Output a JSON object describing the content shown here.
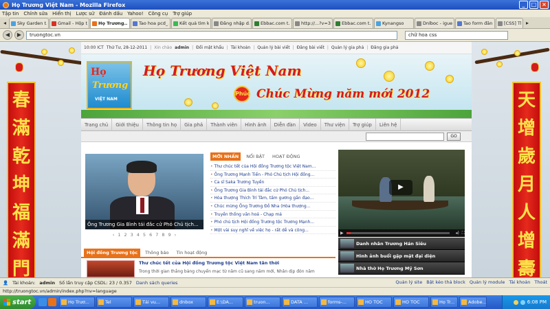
{
  "window": {
    "title": "Họ Trương Việt Nam - Mozilla Firefox",
    "controls": [
      "_",
      "□",
      "×"
    ]
  },
  "menubar": [
    "Tập tin",
    "Chỉnh sửa",
    "Hiển thị",
    "Lược sử",
    "Đánh dấu",
    "Yahoo!",
    "Công cụ",
    "Trợ giúp"
  ],
  "browser_tabs": [
    {
      "label": "Sky Garden t...",
      "color": "#4aa3df"
    },
    {
      "label": "Gmail - Hộp t...",
      "color": "#d93025"
    },
    {
      "label": "Họ Trương...",
      "color": "#e8711a",
      "active": true
    },
    {
      "label": "Tao hoa pcd_...",
      "color": "#5577cc"
    },
    {
      "label": "Kết quả tìm ki...",
      "color": "#3cba54"
    },
    {
      "label": "Đăng nhập d...",
      "color": "#888888"
    },
    {
      "label": "Ebbac.com t...",
      "color": "#2e7d32"
    },
    {
      "label": "http://...?v=3.2",
      "color": "#888888"
    },
    {
      "label": "Ebbac.com t...",
      "color": "#2e7d32"
    },
    {
      "label": "Kynangso",
      "color": "#4aa3df"
    },
    {
      "label": "Dnlboc - igue...",
      "color": "#888888"
    },
    {
      "label": "Tao form đăn...",
      "color": "#5577cc"
    },
    {
      "label": "[CSS] Thay",
      "color": "#888888"
    }
  ],
  "address": {
    "url": "truongtoc.vn",
    "search_value": "chữ hoa css"
  },
  "site": {
    "time": "10:00 ICT",
    "date": "Thứ Tư, 28-12-2011",
    "greeting": "Xin chào",
    "user": "admin",
    "top_links": [
      "Đổi mật khẩu",
      "Tài khoản",
      "Quản lý bài viết",
      "Đăng bài viết",
      "Quản lý gia phả",
      "Đăng gia phả"
    ],
    "logo": {
      "line1": "Họ",
      "line2": "Trương",
      "line3": "VIỆT NAM"
    },
    "banner_title": "Họ Trương Việt Nam",
    "banner_greeting": "Chúc Mừng năm mới 2012",
    "phuc": "Phúc",
    "nav": [
      "Trang chủ",
      "Giới thiệu",
      "Thông tin họ",
      "Gia phả",
      "Thành viên",
      "Hình ảnh",
      "Diễn đàn",
      "Video",
      "Thư viện",
      "Trợ giúp",
      "Liên hệ"
    ],
    "go_label": "GO",
    "featured_caption": "Ông Trương Gia Bình tái đắc cử Phó Chủ tịch...",
    "pager": [
      "‹",
      "1",
      "2",
      "3",
      "4",
      "5",
      "6",
      "7",
      "8",
      "9",
      "›"
    ],
    "news_tabs": [
      "MỚI NHẤN",
      "NỔI BẬT",
      "HOẠT ĐỘNG"
    ],
    "news": [
      "Thư chúc tết của Hội đồng Trương tộc Việt Nam...",
      "Ông Trương Mạnh Tiến - Phó Chủ tịch Hội đồng...",
      "Ca sĩ Saka Trương Tuyền",
      "Ông Trương Gia Bình tái đắc cử Phó Chủ tịch...",
      "Hòa thượng Thích Trí Tâm, tấm gương gắn đạo...",
      "Chúc mừng Ông Trương Đỗ Nha (Hòa thượng...",
      "Truyền thống văn hoá - Chạp mả",
      "Phó chủ tịch Hội đồng Trương tộc Trương Mạnh...",
      "Một vài suy nghĩ về việc họ - rất dễ và công..."
    ],
    "video_list": [
      "Danh nhân Trương Hán Siêu",
      "Hình ảnh buổi gặp mặt đại diện",
      "Nhà thờ Họ Trương Mỹ Sơn"
    ],
    "council_tabs": [
      "Hội đồng Trương tộc",
      "Thông báo",
      "Tin hoạt động"
    ],
    "council_headline": "Thư chúc tết của Hội đồng Trương tộc Việt Nam tân thời",
    "council_excerpt": "Trong thời gian thắng bảng chuyển mạc từ năm cũ sang năm mới, Nhân dịp đón năm"
  },
  "couplets": {
    "left": [
      "春",
      "滿",
      "乾",
      "坤",
      "福",
      "滿",
      "門"
    ],
    "right": [
      "天",
      "增",
      "歲",
      "月",
      "人",
      "增",
      "壽"
    ]
  },
  "sitebar": {
    "account_label": "Tài khoản:",
    "account_user": "admin",
    "sql": "Số lần truy cập CSDL: 23 / 0.357",
    "queries": "Danh sách queries",
    "links": [
      "Quản lý site",
      "Bật kéo thả block",
      "Quản lý module",
      "Tài khoản",
      "Thoát"
    ]
  },
  "status": "http://truongtoc.vn/admin/index.php?nv=language",
  "taskbar": {
    "start": "start",
    "items": [
      "Họ Trươ...",
      "Tel",
      "Tải vu...",
      "dnbox",
      "E:\\DA...",
      "truon...",
      "DATA ...",
      "forms-...",
      "HO TOC",
      "HO TOC",
      "Họ Tr...",
      "Adobe..."
    ],
    "time": "6:08 PM"
  },
  "colors": {
    "accent": "#e8711a",
    "link": "#1b3a8c",
    "banner_red": "#d41c1c",
    "couplet_red": "#c40d0d",
    "couplet_text": "#ffe34a"
  }
}
